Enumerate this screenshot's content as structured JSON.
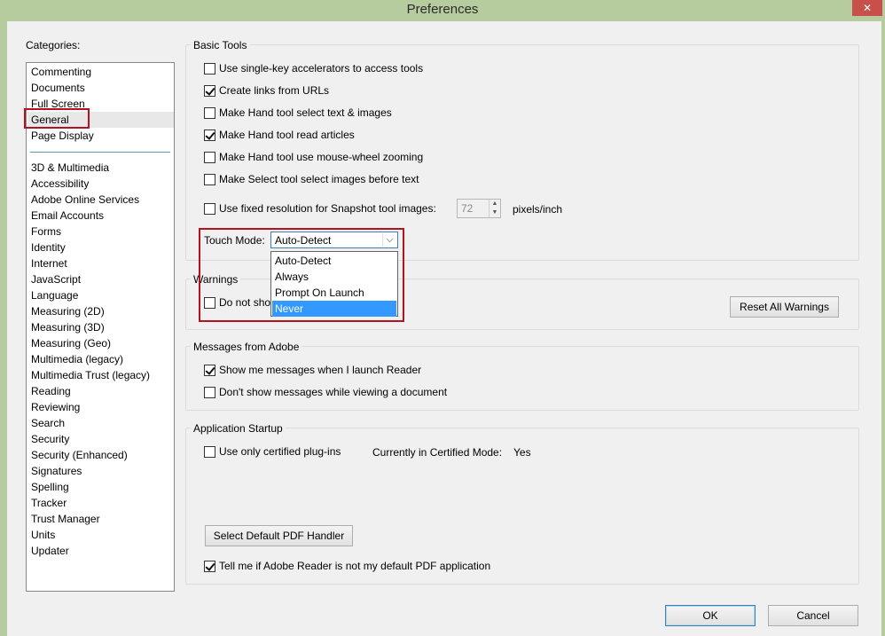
{
  "window": {
    "title": "Preferences",
    "close_glyph": "✕"
  },
  "categories": {
    "label": "Categories:",
    "group1": [
      "Commenting",
      "Documents",
      "Full Screen",
      "General",
      "Page Display"
    ],
    "group2": [
      "3D & Multimedia",
      "Accessibility",
      "Adobe Online Services",
      "Email Accounts",
      "Forms",
      "Identity",
      "Internet",
      "JavaScript",
      "Language",
      "Measuring (2D)",
      "Measuring (3D)",
      "Measuring (Geo)",
      "Multimedia (legacy)",
      "Multimedia Trust (legacy)",
      "Reading",
      "Reviewing",
      "Search",
      "Security",
      "Security (Enhanced)",
      "Signatures",
      "Spelling",
      "Tracker",
      "Trust Manager",
      "Units",
      "Updater"
    ],
    "selected": "General"
  },
  "basic_tools": {
    "title": "Basic Tools",
    "options": [
      {
        "label": "Use single-key accelerators to access tools",
        "checked": false
      },
      {
        "label": "Create links from URLs",
        "checked": true
      },
      {
        "label": "Make Hand tool select text & images",
        "checked": false
      },
      {
        "label": "Make Hand tool read articles",
        "checked": true
      },
      {
        "label": "Make Hand tool use mouse-wheel zooming",
        "checked": false
      },
      {
        "label": "Make Select tool select images before text",
        "checked": false
      }
    ],
    "snapshot_label": "Use fixed resolution for Snapshot tool images:",
    "snapshot_checked": false,
    "snapshot_value": "72",
    "snapshot_unit": "pixels/inch",
    "touch_mode_label": "Touch Mode:",
    "touch_mode_value": "Auto-Detect",
    "touch_mode_options": [
      "Auto-Detect",
      "Always",
      "Prompt On Launch",
      "Never"
    ],
    "touch_mode_highlighted": "Never"
  },
  "warnings": {
    "title": "Warnings",
    "option_label": "Do not show",
    "option_checked": false,
    "reset_button": "Reset All Warnings"
  },
  "messages": {
    "title": "Messages from Adobe",
    "options": [
      {
        "label": "Show me messages when I launch Reader",
        "checked": true
      },
      {
        "label": "Don't show messages while viewing a document",
        "checked": false
      }
    ]
  },
  "startup": {
    "title": "Application Startup",
    "certified_label": "Use only certified plug-ins",
    "certified_checked": false,
    "certified_mode_label": "Currently in Certified Mode:",
    "certified_mode_value": "Yes",
    "default_handler_button": "Select Default PDF Handler",
    "default_reader_label": "Tell me if Adobe Reader is not my default PDF application",
    "default_reader_checked": true
  },
  "footer": {
    "ok": "OK",
    "cancel": "Cancel"
  },
  "colors": {
    "titlebar": "#b7cc9e",
    "highlight": "#3399ff",
    "callout": "#b3131d",
    "close": "#c7504a"
  }
}
